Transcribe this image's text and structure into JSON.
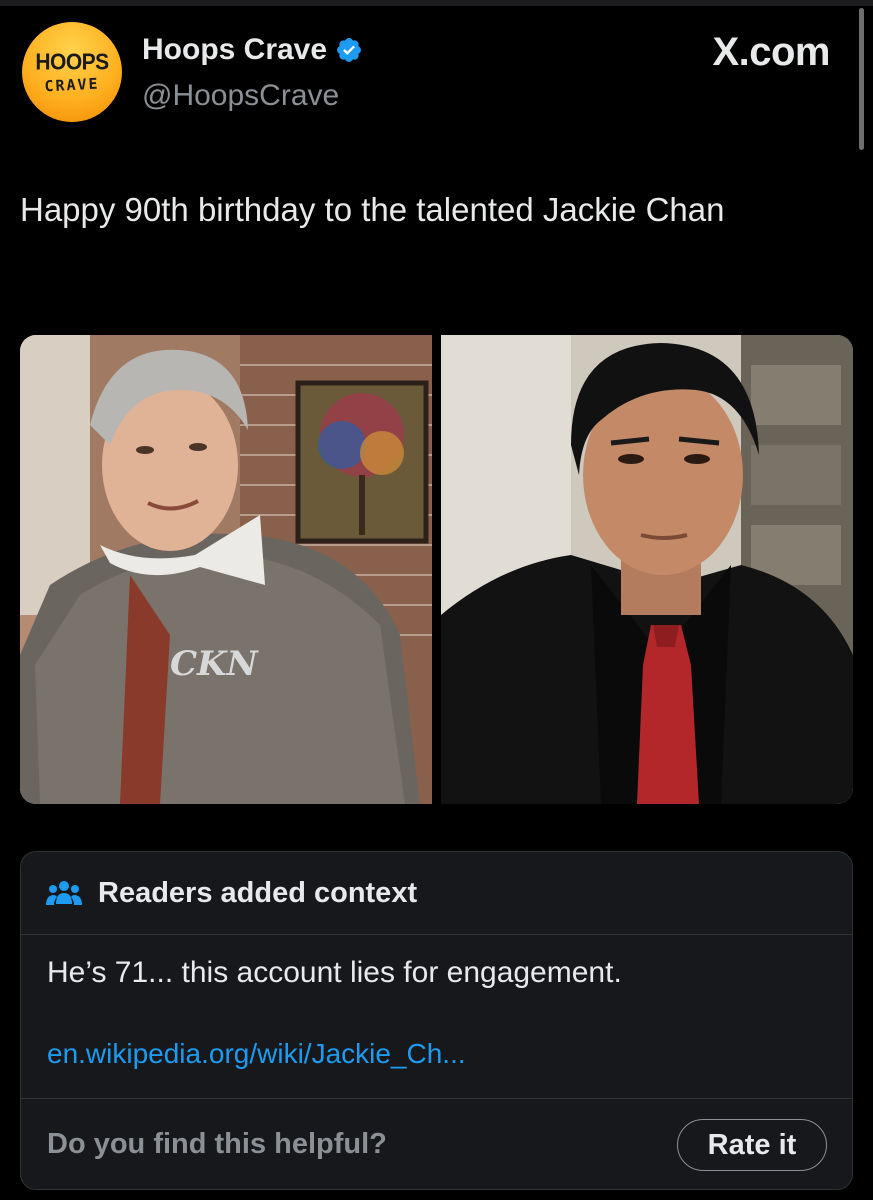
{
  "author": {
    "avatar_text_top": "HOOPS",
    "avatar_text_bottom": "CRAVE",
    "display_name": "Hoops Crave",
    "handle": "@HoopsCrave",
    "verified": true
  },
  "site_label": "X.com",
  "post": {
    "text": "Happy 90th birthday to the talented Jackie Chan",
    "media": [
      {
        "description_icon": "photo-older-man-grey-jacket"
      },
      {
        "description_icon": "photo-man-black-suit-red-tie"
      }
    ]
  },
  "community_note": {
    "title": "Readers added context",
    "body": "He’s 71... this account lies for engagement.",
    "link": "en.wikipedia.org/wiki/Jackie_Ch...",
    "helpful_prompt": "Do you find this helpful?",
    "rate_button": "Rate it"
  },
  "colors": {
    "background": "#000000",
    "text": "#e7e9ea",
    "muted": "#8b9096",
    "link": "#1d9bf0",
    "verified": "#1d9bf0",
    "note_background": "#16181c"
  }
}
